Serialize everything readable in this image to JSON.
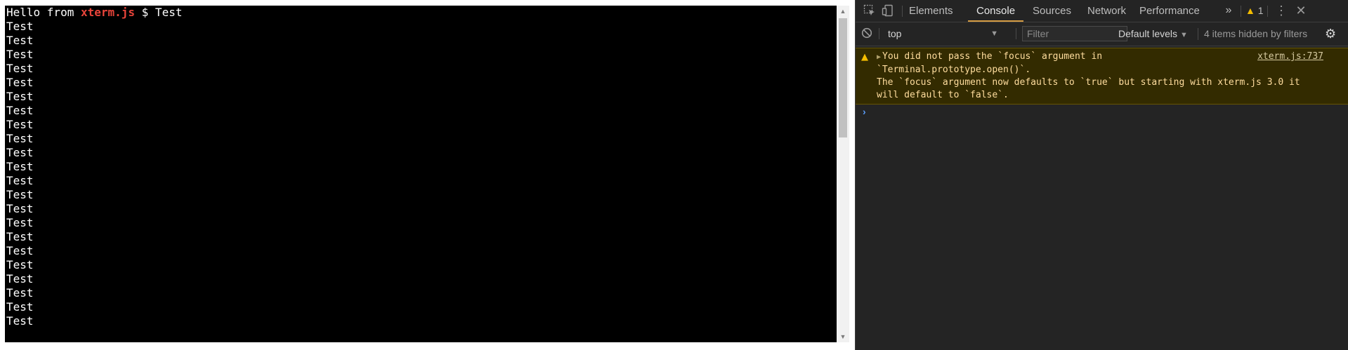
{
  "terminal": {
    "prompt_prefix": "Hello from ",
    "prompt_brand": "xterm.js",
    "prompt_suffix": " $ Test",
    "output_lines": [
      "Test",
      "Test",
      "Test",
      "Test",
      "Test",
      "Test",
      "Test",
      "Test",
      "Test",
      "Test",
      "Test",
      "Test",
      "Test",
      "Test",
      "Test",
      "Test",
      "Test",
      "Test",
      "Test",
      "Test",
      "Test",
      "Test"
    ],
    "brand_color": "#e8443a"
  },
  "devtools": {
    "tabs": [
      {
        "label": "Elements",
        "active": false
      },
      {
        "label": "Console",
        "active": true
      },
      {
        "label": "Sources",
        "active": false
      },
      {
        "label": "Network",
        "active": false
      },
      {
        "label": "Performance",
        "active": false
      }
    ],
    "more_tabs_icon": "double-chevron-icon",
    "warning_count": "1",
    "filterbar": {
      "context": "top",
      "filter_placeholder": "Filter",
      "levels": "Default levels",
      "hidden_info": "4 items hidden by filters"
    },
    "messages": [
      {
        "level": "warning",
        "source": "xterm.js:737",
        "lines": [
          "You did not pass the `focus` argument in",
          "`Terminal.prototype.open()`.",
          "The `focus` argument now defaults to `true` but starting with xterm.js 3.0 it",
          "will default to `false`."
        ]
      }
    ]
  }
}
